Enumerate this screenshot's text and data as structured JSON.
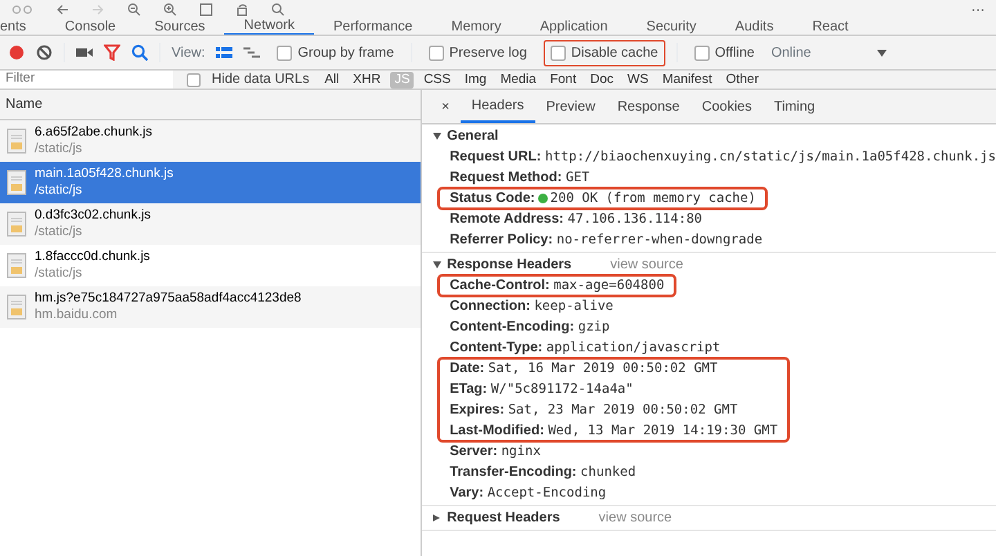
{
  "browser_toolbar": {
    "more": "···"
  },
  "devtools_tabs": [
    {
      "label": "ents",
      "selected": false
    },
    {
      "label": "Console",
      "selected": false
    },
    {
      "label": "Sources",
      "selected": false
    },
    {
      "label": "Network",
      "selected": true
    },
    {
      "label": "Performance",
      "selected": false
    },
    {
      "label": "Memory",
      "selected": false
    },
    {
      "label": "Application",
      "selected": false
    },
    {
      "label": "Security",
      "selected": false
    },
    {
      "label": "Audits",
      "selected": false
    },
    {
      "label": "React",
      "selected": false
    }
  ],
  "network_toolbar": {
    "recording": true,
    "filter_on": true,
    "view_label": "View:",
    "large_rows": true,
    "checkboxes": [
      {
        "label": "Group by frame",
        "checked": false,
        "highlighted": false
      },
      {
        "label": "Preserve log",
        "checked": false,
        "highlighted": false
      },
      {
        "label": "Disable cache",
        "checked": false,
        "highlighted": true
      },
      {
        "label": "Offline",
        "checked": false,
        "highlighted": false
      }
    ],
    "throttling": "Online"
  },
  "filter_bar": {
    "placeholder": "Filter",
    "hide_data_urls": {
      "label": "Hide data URLs",
      "checked": false
    },
    "types": [
      {
        "label": "All",
        "selected": false
      },
      {
        "label": "XHR",
        "selected": false
      },
      {
        "label": "JS",
        "selected": true
      },
      {
        "label": "CSS",
        "selected": false
      },
      {
        "label": "Img",
        "selected": false
      },
      {
        "label": "Media",
        "selected": false
      },
      {
        "label": "Font",
        "selected": false
      },
      {
        "label": "Doc",
        "selected": false
      },
      {
        "label": "WS",
        "selected": false
      },
      {
        "label": "Manifest",
        "selected": false
      },
      {
        "label": "Other",
        "selected": false
      }
    ]
  },
  "requests": {
    "column": "Name",
    "rows": [
      {
        "name": "6.a65f2abe.chunk.js",
        "path": "/static/js",
        "selected": false
      },
      {
        "name": "main.1a05f428.chunk.js",
        "path": "/static/js",
        "selected": true
      },
      {
        "name": "0.d3fc3c02.chunk.js",
        "path": "/static/js",
        "selected": false
      },
      {
        "name": "1.8faccc0d.chunk.js",
        "path": "/static/js",
        "selected": false
      },
      {
        "name": "hm.js?e75c184727a975aa58adf4acc4123de8",
        "path": "hm.baidu.com",
        "selected": false
      }
    ]
  },
  "detail": {
    "close": "×",
    "tabs": [
      {
        "label": "Headers",
        "selected": true
      },
      {
        "label": "Preview",
        "selected": false
      },
      {
        "label": "Response",
        "selected": false
      },
      {
        "label": "Cookies",
        "selected": false
      },
      {
        "label": "Timing",
        "selected": false
      }
    ],
    "sections": [
      {
        "title": "General",
        "expanded": true,
        "groups": [
          {
            "highlighted": false,
            "headers": [
              {
                "name": "Request URL:",
                "value": "http://biaochenxuying.cn/static/js/main.1a05f428.chunk.js"
              },
              {
                "name": "Request Method:",
                "value": "GET"
              }
            ]
          },
          {
            "highlighted": true,
            "headers": [
              {
                "name": "Status Code:",
                "value": "200 OK (from memory cache)",
                "color": "#3cb043"
              }
            ]
          },
          {
            "highlighted": false,
            "headers": [
              {
                "name": "Remote Address:",
                "value": "47.106.136.114:80"
              },
              {
                "name": "Referrer Policy:",
                "value": "no-referrer-when-downgrade"
              }
            ]
          }
        ]
      },
      {
        "title": "Response Headers",
        "link": "view source",
        "expanded": true,
        "groups": [
          {
            "highlighted": true,
            "headers": [
              {
                "name": "Cache-Control:",
                "value": "max-age=604800"
              }
            ]
          },
          {
            "highlighted": false,
            "headers": [
              {
                "name": "Connection:",
                "value": "keep-alive"
              },
              {
                "name": "Content-Encoding:",
                "value": "gzip"
              },
              {
                "name": "Content-Type:",
                "value": "application/javascript"
              }
            ]
          },
          {
            "highlighted": true,
            "headers": [
              {
                "name": "Date:",
                "value": "Sat, 16 Mar 2019 00:50:02 GMT"
              },
              {
                "name": "ETag:",
                "value": "W/\"5c891172-14a4a\""
              },
              {
                "name": "Expires:",
                "value": "Sat, 23 Mar 2019 00:50:02 GMT"
              },
              {
                "name": "Last-Modified:",
                "value": "Wed, 13 Mar 2019 14:19:30 GMT"
              }
            ]
          },
          {
            "highlighted": false,
            "headers": [
              {
                "name": "Server:",
                "value": "nginx"
              },
              {
                "name": "Transfer-Encoding:",
                "value": "chunked"
              },
              {
                "name": "Vary:",
                "value": "Accept-Encoding"
              }
            ]
          }
        ]
      },
      {
        "title": "Request Headers",
        "link": "view source",
        "expanded": false
      }
    ]
  }
}
